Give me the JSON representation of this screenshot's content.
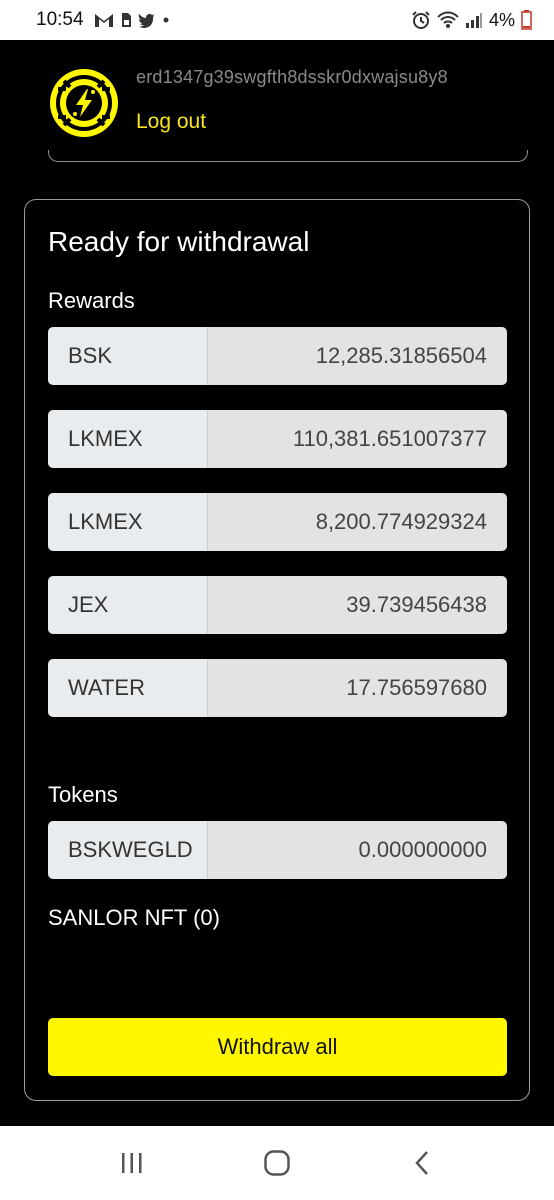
{
  "status_bar": {
    "time": "10:54",
    "battery": "4%",
    "icons": [
      "gmail-icon",
      "sim-icon",
      "twitter-icon",
      "dot-icon",
      "alarm-icon",
      "wifi-icon",
      "signal-icon",
      "battery-icon"
    ]
  },
  "header": {
    "address": "erd1347g39swgfth8dsskr0dxwajsu8y8",
    "logout_label": "Log out"
  },
  "card": {
    "title": "Ready for withdrawal",
    "rewards_label": "Rewards",
    "rewards": [
      {
        "symbol": "BSK",
        "amount": "12,285.31856504"
      },
      {
        "symbol": "LKMEX",
        "amount": "110,381.651007377"
      },
      {
        "symbol": "LKMEX",
        "amount": "8,200.774929324"
      },
      {
        "symbol": "JEX",
        "amount": "39.739456438"
      },
      {
        "symbol": "WATER",
        "amount": "17.756597680"
      }
    ],
    "tokens_label": "Tokens",
    "tokens": [
      {
        "symbol": "BSKWEGLD",
        "amount": "0.000000000"
      }
    ],
    "nft_label": "SANLOR NFT (0)",
    "withdraw_label": "Withdraw all"
  },
  "colors": {
    "accent_yellow": "#fff700",
    "link_yellow": "#f6e51d",
    "background": "#000000"
  },
  "nav_bar": {
    "icons": [
      "recent-apps-icon",
      "home-icon",
      "back-icon"
    ]
  }
}
